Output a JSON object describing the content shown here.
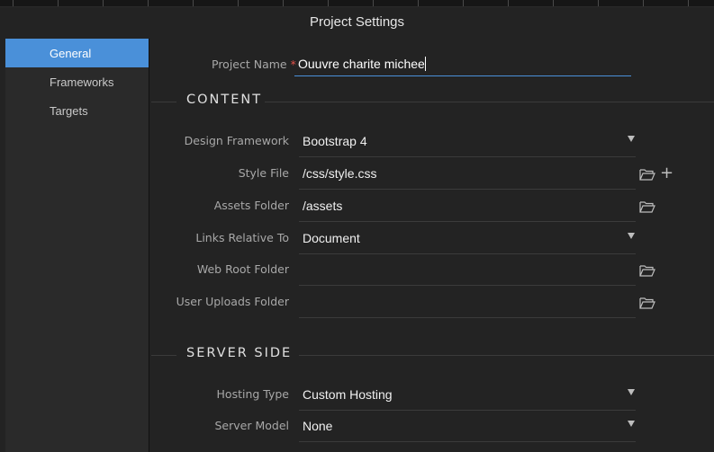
{
  "dialog": {
    "title": "Project Settings"
  },
  "sidebar": {
    "items": [
      {
        "label": "General",
        "active": true
      },
      {
        "label": "Frameworks",
        "active": false
      },
      {
        "label": "Targets",
        "active": false
      }
    ]
  },
  "project_name": {
    "label": "Project Name",
    "required_marker": "*",
    "value": "Ouuvre charite michee"
  },
  "content_section": {
    "title": "CONTENT",
    "fields": {
      "design_framework": {
        "label": "Design Framework",
        "value": "Bootstrap 4",
        "icon": "chevron-down-icon"
      },
      "style_file": {
        "label": "Style File",
        "value": "/css/style.css",
        "icons": [
          "folder-icon",
          "plus-icon"
        ]
      },
      "assets_folder": {
        "label": "Assets Folder",
        "value": "/assets",
        "icon": "folder-icon"
      },
      "links_relative_to": {
        "label": "Links Relative To",
        "value": "Document",
        "icon": "chevron-down-icon"
      },
      "web_root_folder": {
        "label": "Web Root Folder",
        "value": "",
        "icon": "folder-icon"
      },
      "user_uploads_folder": {
        "label": "User Uploads Folder",
        "value": "",
        "icon": "folder-icon"
      }
    }
  },
  "server_section": {
    "title": "SERVER SIDE",
    "fields": {
      "hosting_type": {
        "label": "Hosting Type",
        "value": "Custom Hosting",
        "icon": "chevron-down-icon"
      },
      "server_model": {
        "label": "Server Model",
        "value": "None",
        "icon": "chevron-down-icon"
      }
    }
  },
  "colors": {
    "accent": "#4a90d9",
    "required": "#e2524a",
    "background": "#232323",
    "sidebar": "#2a2a2a"
  }
}
